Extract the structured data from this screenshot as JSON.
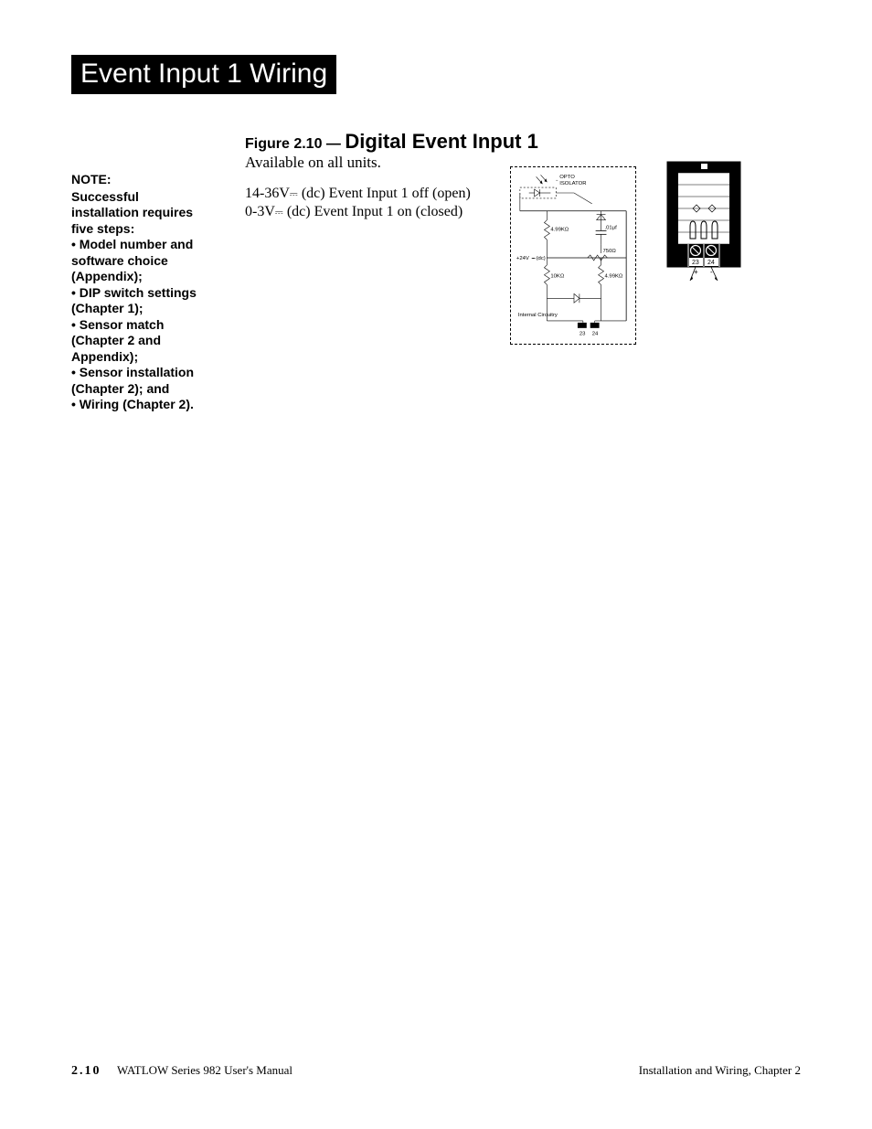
{
  "page_title": "Event Input 1 Wiring",
  "figure": {
    "prefix": "Figure 2.10 — ",
    "title": "Digital Event Input 1",
    "availability": "Available on all units."
  },
  "voltage": {
    "line1_a": "14-36V",
    "line1_b": " (dc) Event Input 1 off (open)",
    "line2_a": "0-3V",
    "line2_b": " (dc) Event Input 1 on (closed)"
  },
  "note": {
    "title": "NOTE:",
    "intro": "Successful installation requires five steps:",
    "items": [
      "• Model number and software choice (Appendix);",
      "• DIP switch settings (Chapter 1);",
      "• Sensor match (Chapter 2 and Appendix);",
      "• Sensor installation (Chapter 2); and",
      "• Wiring (Chapter 2)."
    ]
  },
  "circuit": {
    "opto": "OPTO",
    "isolator": "ISOLATOR",
    "r1": "4.99KΩ",
    "c1": ".01μf",
    "v24": "+24V",
    "dc": "(dc)",
    "rwave": "750Ω",
    "r10k": "10KΩ",
    "r2": "4.99KΩ",
    "internal": "Internal Circuitry",
    "t23": "23",
    "t24": "24"
  },
  "terminal": {
    "t23": "23",
    "t24": "24",
    "plus": "+",
    "minus": "-"
  },
  "footer": {
    "page": "2.10",
    "manual": "WATLOW Series 982 User's Manual",
    "chapter": "Installation and Wiring, Chapter 2"
  }
}
